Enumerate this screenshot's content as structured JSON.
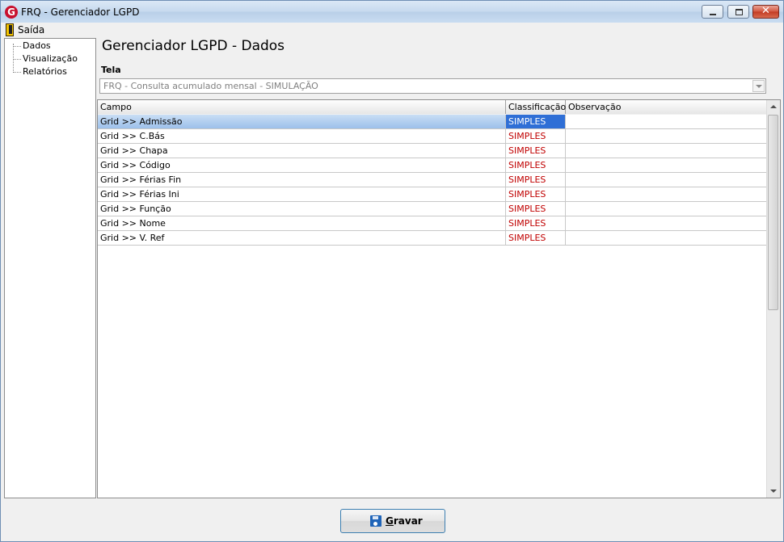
{
  "window": {
    "title": "FRQ - Gerenciador LGPD",
    "app_icon_letter": "G"
  },
  "menu": {
    "exit_label": "Saída"
  },
  "tree": {
    "items": [
      "Dados",
      "Visualização",
      "Relatórios"
    ]
  },
  "page": {
    "title": "Gerenciador LGPD - Dados"
  },
  "screen_selector": {
    "label": "Tela",
    "value": "FRQ - Consulta acumulado mensal - SIMULAÇÃO"
  },
  "grid": {
    "headers": [
      "Campo",
      "Classificação",
      "Observação"
    ],
    "rows": [
      {
        "campo": "Grid >> Admissão",
        "classificacao": "SIMPLES",
        "observacao": ""
      },
      {
        "campo": "Grid >> C.Bás",
        "classificacao": "SIMPLES",
        "observacao": ""
      },
      {
        "campo": "Grid >> Chapa",
        "classificacao": "SIMPLES",
        "observacao": ""
      },
      {
        "campo": "Grid >> Código",
        "classificacao": "SIMPLES",
        "observacao": ""
      },
      {
        "campo": "Grid >> Férias Fin",
        "classificacao": "SIMPLES",
        "observacao": ""
      },
      {
        "campo": "Grid >> Férias Ini",
        "classificacao": "SIMPLES",
        "observacao": ""
      },
      {
        "campo": "Grid >> Função",
        "classificacao": "SIMPLES",
        "observacao": ""
      },
      {
        "campo": "Grid >> Nome",
        "classificacao": "SIMPLES",
        "observacao": ""
      },
      {
        "campo": "Grid >> V. Ref",
        "classificacao": "SIMPLES",
        "observacao": ""
      }
    ],
    "selected_row": 0
  },
  "footer": {
    "save_first_letter": "G",
    "save_rest": "ravar"
  },
  "colors": {
    "classification_text": "#c00000",
    "selection": "#2f6fd6"
  }
}
